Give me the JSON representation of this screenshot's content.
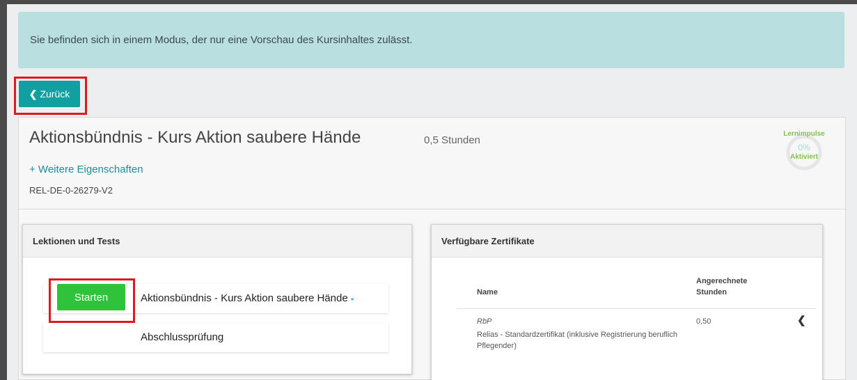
{
  "alert": {
    "text": "Sie befinden sich in einem Modus, der nur eine Vorschau des Kursinhaltes zulässt."
  },
  "back_button": {
    "icon": "chevron-left-icon",
    "label": "Zurück"
  },
  "course": {
    "title": "Aktionsbündnis - Kurs Aktion saubere Hände",
    "hours": "0,5 Stunden",
    "more_properties": "+ Weitere Eigenschaften",
    "id": "REL-DE-0-26279-V2",
    "progress": {
      "label_top": "Lernimpulse",
      "percent": "0%",
      "label_bottom": "Aktiviert",
      "value": 0
    }
  },
  "lessons_panel": {
    "title": "Lektionen und Tests",
    "start_label": "Starten",
    "items": [
      {
        "label": "Aktionsbündnis - Kurs Aktion saubere Hände",
        "arrow": "▸"
      },
      {
        "label": "Abschlussprüfung"
      }
    ]
  },
  "certificates_panel": {
    "title": "Verfügbare Zertifikate",
    "columns": [
      "Name",
      "Angerechnete Stunden"
    ],
    "rows": [
      {
        "short": "RbP",
        "name": "Relias - Standardzertifikat (inklusive Registrierung beruflich Pflegender)",
        "hours": "0,50",
        "icon": "chevron-left-icon"
      }
    ]
  },
  "colors": {
    "alert_bg": "#b9dfe0",
    "back_button": "#10a0a2",
    "start_button": "#2ec33b",
    "highlight": "#e0191f",
    "link": "#1c8e9a",
    "progress_label": "#7fc34a"
  }
}
